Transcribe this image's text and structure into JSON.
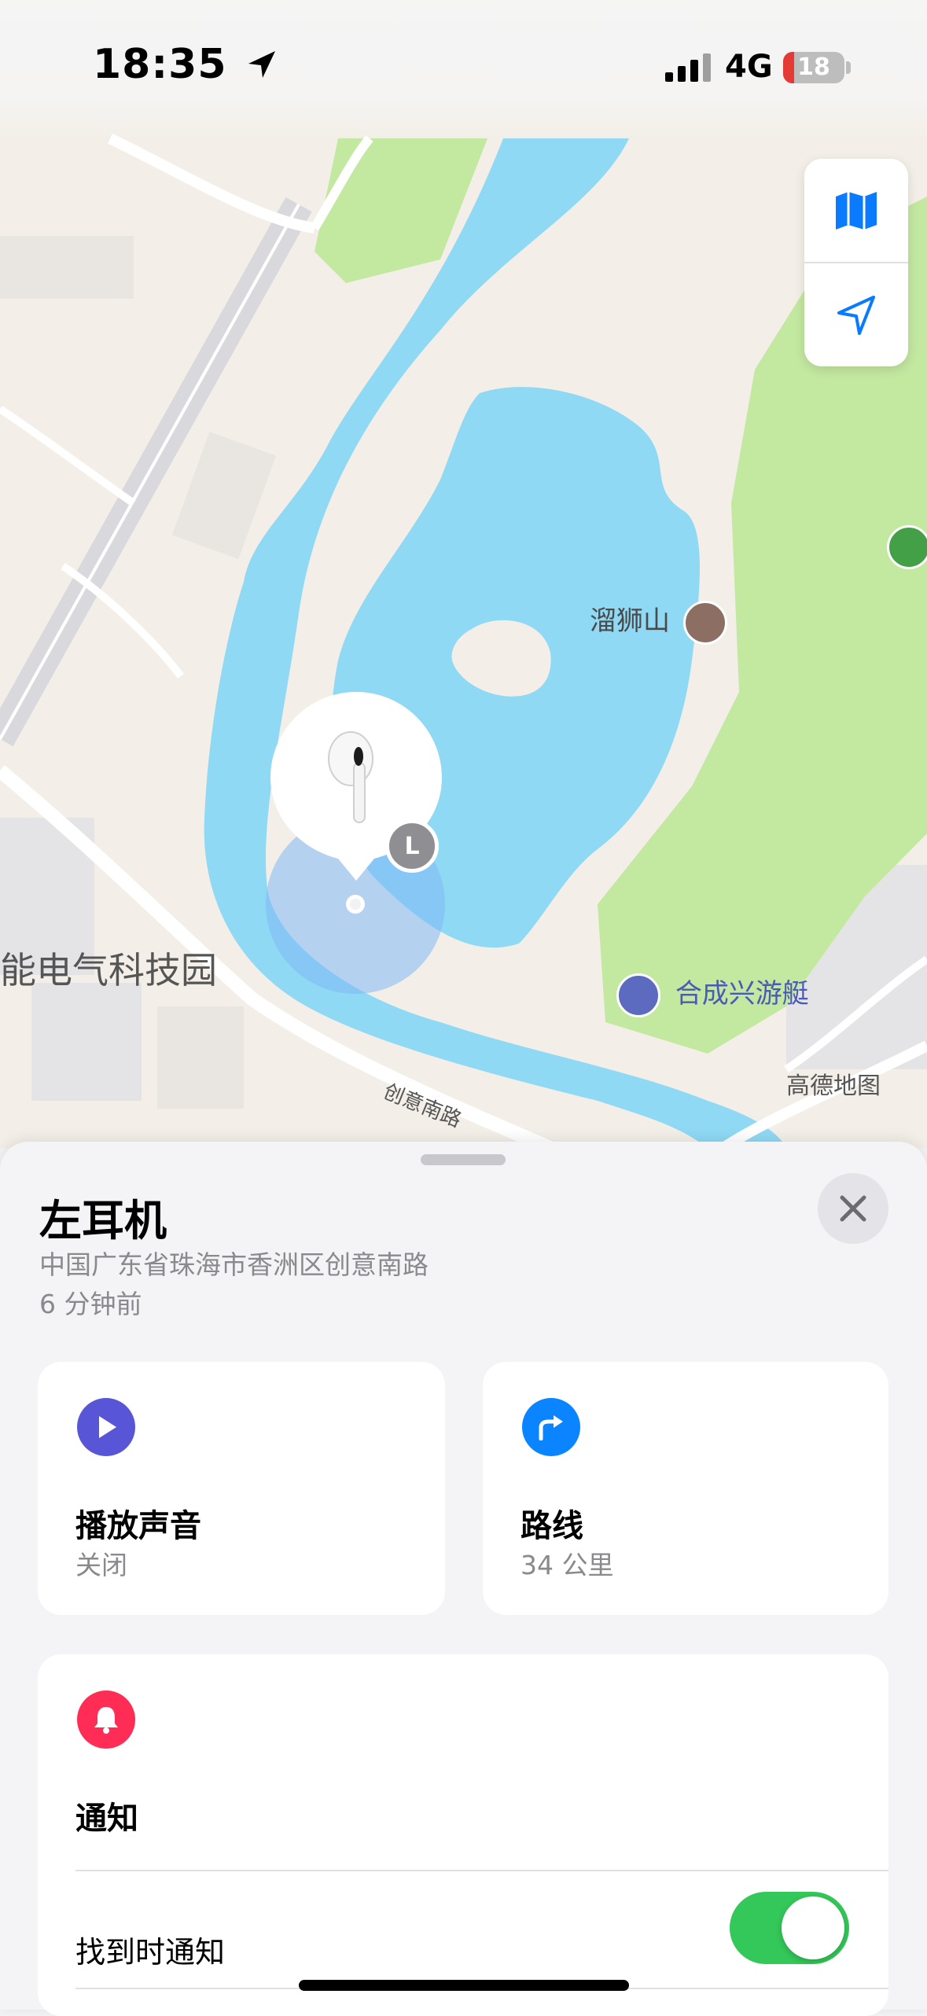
{
  "status_bar": {
    "time": "18:35",
    "network": "4G",
    "battery_level": "18"
  },
  "map": {
    "poi_label_1": "溜狮山",
    "poi_label_2": "合成兴游艇",
    "area_label": "能电气科技园",
    "road_label": "创意南路",
    "attribution": "高德地图",
    "device_badge": "L",
    "colors": {
      "water": "#8fd9f4",
      "park": "#c3e8a0",
      "land": "#f3efe8"
    }
  },
  "map_controls": {
    "map_mode_icon": "map-icon",
    "locate_icon": "location-arrow-icon"
  },
  "sheet": {
    "title": "左耳机",
    "address": "中国广东省珠海市香洲区创意南路",
    "time_ago": "6 分钟前",
    "cards": {
      "play_sound": {
        "title": "播放声音",
        "status": "关闭",
        "icon": "play-icon",
        "color": "#5856d6"
      },
      "directions": {
        "title": "路线",
        "distance": "34 公里",
        "icon": "turn-right-arrow-icon",
        "color": "#0a84ff"
      }
    },
    "notifications": {
      "title": "通知",
      "icon": "bell-icon",
      "color": "#ff2d55",
      "notify_when_found_label": "找到时通知",
      "notify_when_found_on": true
    }
  }
}
